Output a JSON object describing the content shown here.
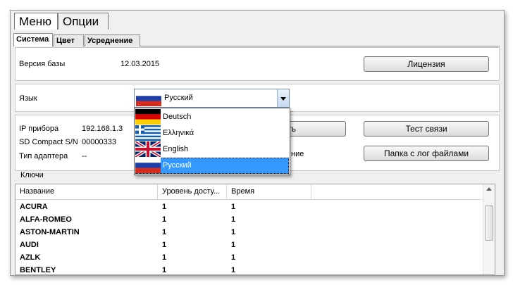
{
  "menu": {
    "items": [
      {
        "label": "Меню"
      },
      {
        "label": "Опции"
      }
    ]
  },
  "tabs": [
    {
      "label": "Система"
    },
    {
      "label": "Цвет"
    },
    {
      "label": "Усреднение"
    }
  ],
  "db": {
    "label": "Версия базы",
    "value": "12.03.2015",
    "license_button": "Лицензия"
  },
  "language": {
    "label": "Язык",
    "selected": "Русский",
    "options": [
      {
        "label": "Deutsch",
        "flag": "germany-flag"
      },
      {
        "label": "Ελληνικά",
        "flag": "greece-flag"
      },
      {
        "label": "English",
        "flag": "uk-flag"
      },
      {
        "label": "Русский",
        "flag": "russia-flag"
      }
    ]
  },
  "device": {
    "ip_label": "IP прибора",
    "ip_value": "192.168.1.3",
    "sn_label": "SD Compact S/N",
    "sn_value": "00000333",
    "adapter_label": "Тип адаптера",
    "adapter_value": "--",
    "hidden_button_tail": "ть",
    "hidden_text_tail": "ние",
    "test_button": "Тест связи",
    "logs_button": "Папка с лог файлами"
  },
  "keys": {
    "caption": "Ключи",
    "columns": [
      "Название",
      "Уровень досту...",
      "Время"
    ],
    "rows": [
      [
        "ACURA",
        "1",
        "1"
      ],
      [
        "ALFA-ROMEO",
        "1",
        "1"
      ],
      [
        "ASTON-MARTIN",
        "1",
        "1"
      ],
      [
        "AUDI",
        "1",
        "1"
      ],
      [
        "AZLK",
        "1",
        "1"
      ],
      [
        "BENTLEY",
        "1",
        "1"
      ]
    ]
  },
  "colors": {
    "selection": "#3399ff",
    "panel": "#f0f0f0"
  }
}
